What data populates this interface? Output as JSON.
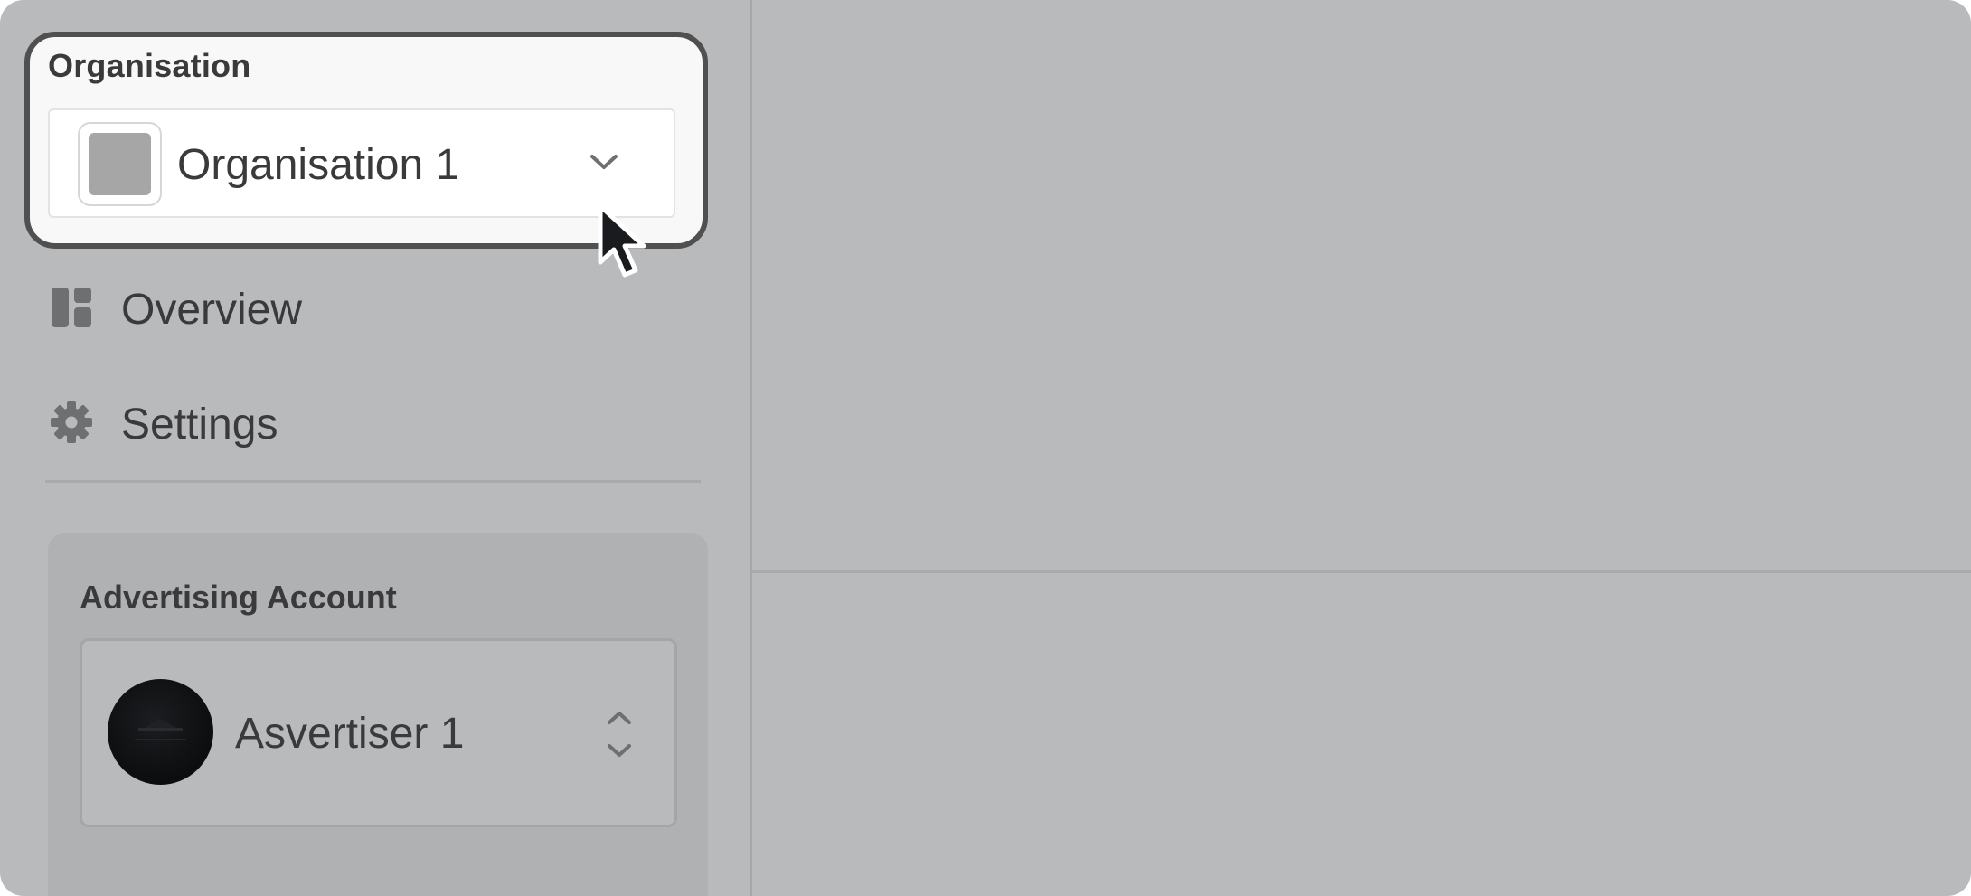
{
  "organisation": {
    "label": "Organisation",
    "selected": "Organisation 1",
    "chevron_icon": "chevron-down-icon"
  },
  "nav": {
    "items": [
      {
        "label": "Overview",
        "icon": "dashboard-icon"
      },
      {
        "label": "Settings",
        "icon": "gear-icon"
      }
    ]
  },
  "advertising_account": {
    "label": "Advertising Account",
    "selected": "Asvertiser 1",
    "selector_icon": "chevron-up-down-icon"
  },
  "colors": {
    "background": "#b9babc",
    "text": "#3a3a3c",
    "highlight_border": "#505050",
    "icon": "#6e6f71"
  }
}
